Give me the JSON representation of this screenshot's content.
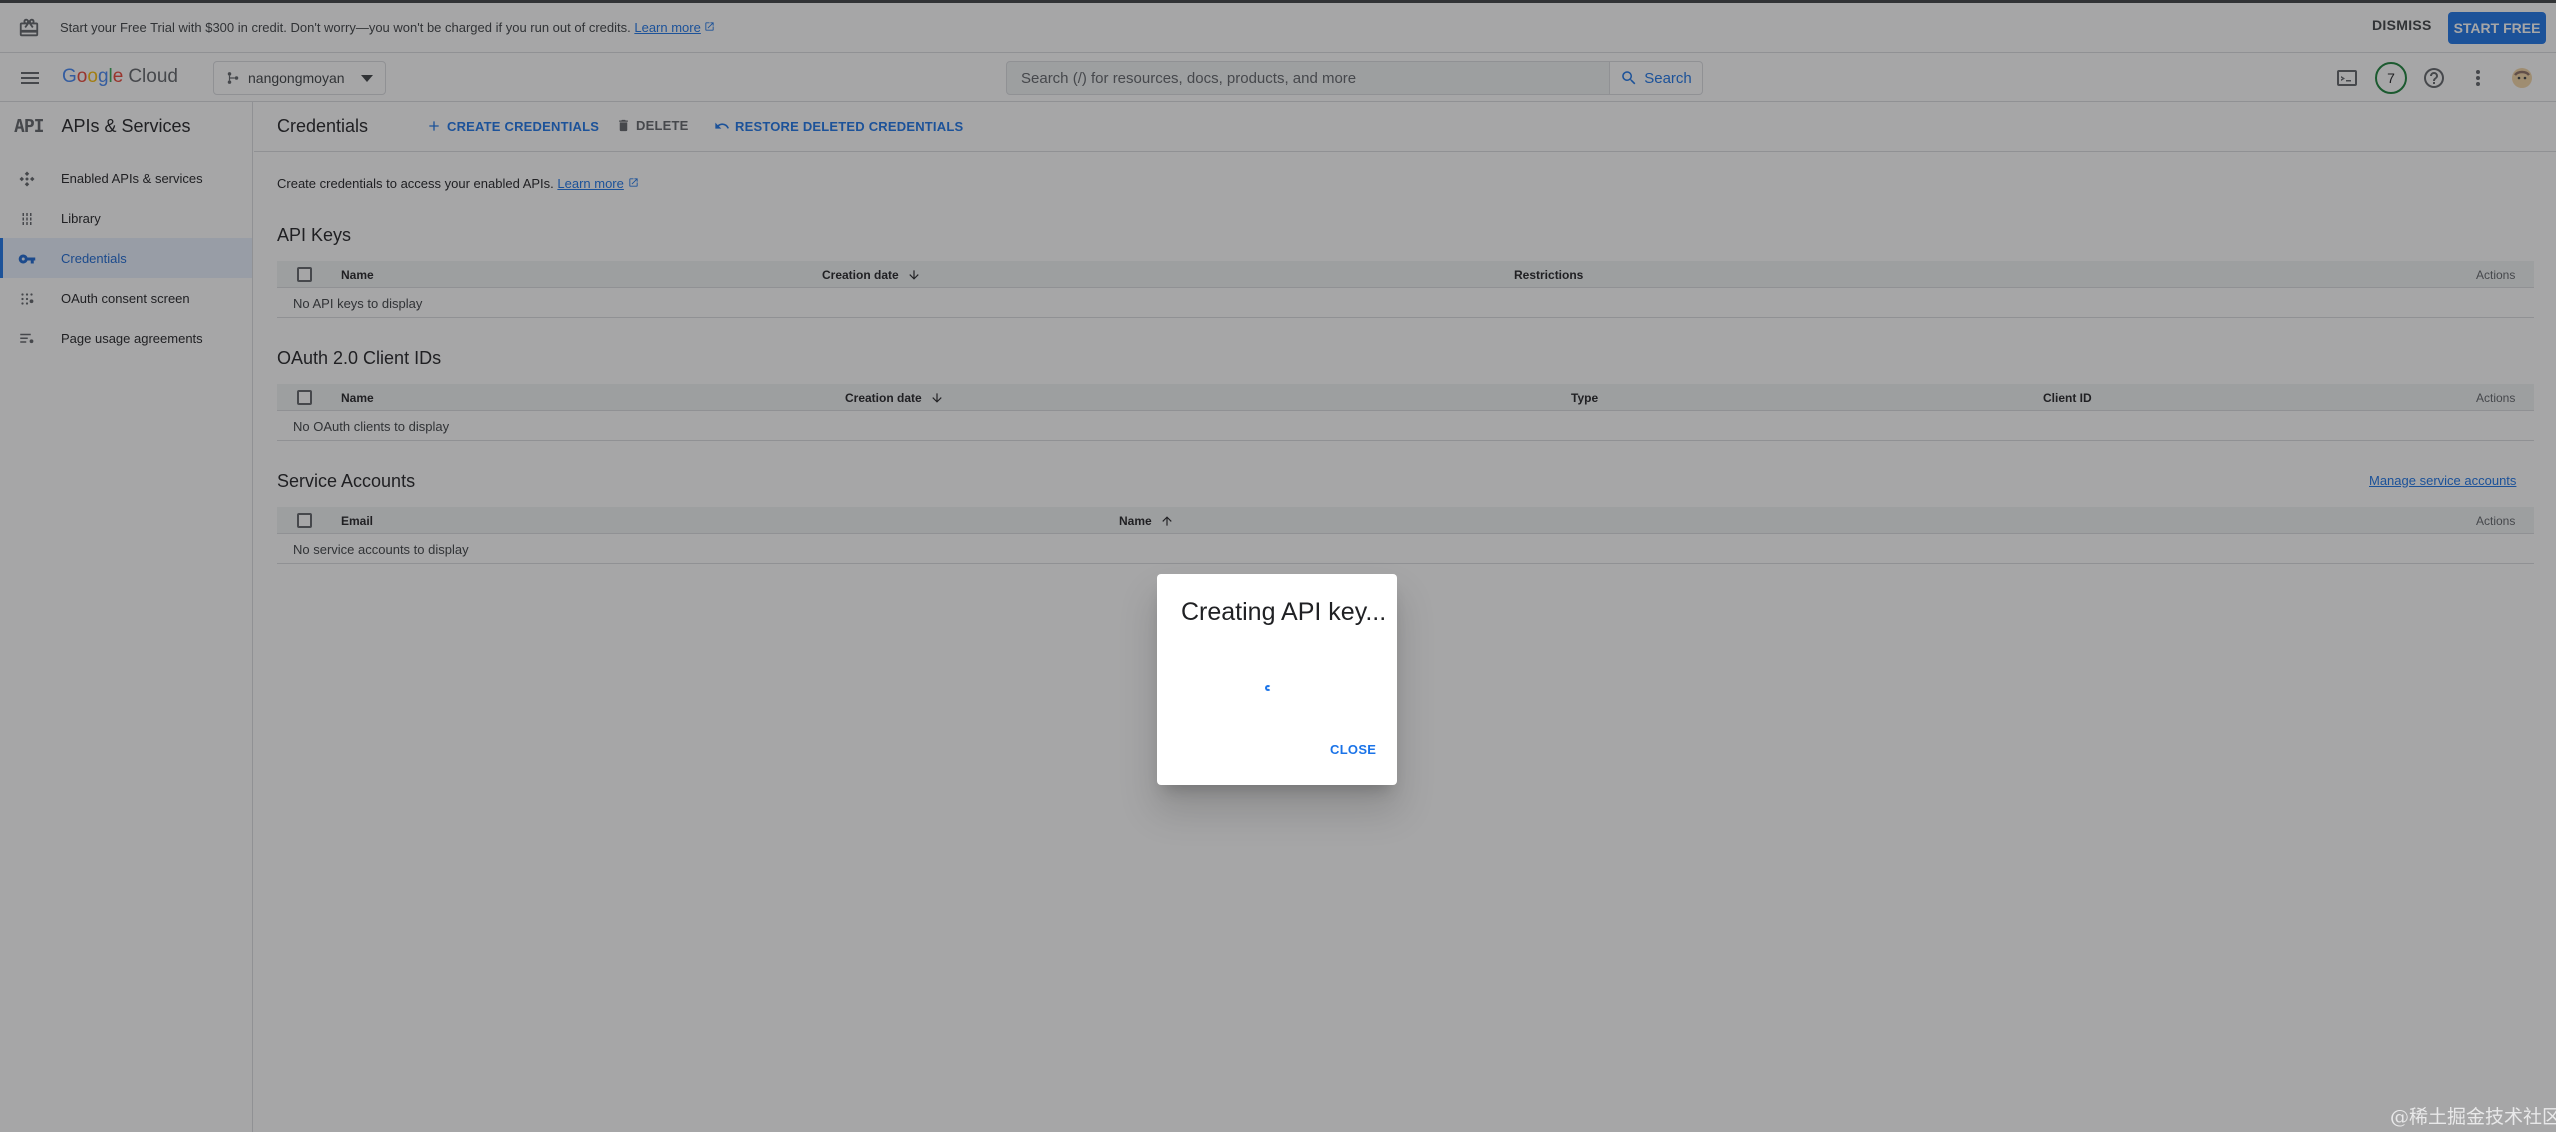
{
  "trial_banner": {
    "message": "Start your Free Trial with $300 in credit. Don't worry—you won't be charged if you run out of credits.",
    "learn_more": "Learn more",
    "dismiss": "DISMISS",
    "start_free": "START FREE"
  },
  "header": {
    "logo_google": "Google",
    "logo_cloud": "Cloud",
    "project": "nangongmoyan",
    "search_placeholder": "Search (/) for resources, docs, products, and more",
    "search_button": "Search",
    "notification_count": "7"
  },
  "sidebar": {
    "logo": "API",
    "title": "APIs & Services",
    "items": [
      {
        "label": "Enabled APIs & services",
        "icon": "hub-icon"
      },
      {
        "label": "Library",
        "icon": "library-grid-icon"
      },
      {
        "label": "Credentials",
        "icon": "key-icon",
        "active": true
      },
      {
        "label": "OAuth consent screen",
        "icon": "consent-dots-icon"
      },
      {
        "label": "Page usage agreements",
        "icon": "settings-list-icon"
      }
    ]
  },
  "toolbar": {
    "title": "Credentials",
    "create": "CREATE CREDENTIALS",
    "delete": "DELETE",
    "restore": "RESTORE DELETED CREDENTIALS"
  },
  "main": {
    "intro": "Create credentials to access your enabled APIs.",
    "learn_more": "Learn more",
    "api_keys": {
      "title": "API Keys",
      "columns": [
        "Name",
        "Creation date",
        "Restrictions",
        "Actions"
      ],
      "empty": "No API keys to display"
    },
    "oauth": {
      "title": "OAuth 2.0 Client IDs",
      "columns": [
        "Name",
        "Creation date",
        "Type",
        "Client ID",
        "Actions"
      ],
      "empty": "No OAuth clients to display"
    },
    "service_accounts": {
      "title": "Service Accounts",
      "manage_link": "Manage service accounts",
      "columns": [
        "Email",
        "Name",
        "Actions"
      ],
      "empty": "No service accounts to display"
    }
  },
  "dialog": {
    "title": "Creating API key...",
    "close": "CLOSE"
  },
  "watermark": "@稀土掘金技术社区",
  "colors": {
    "accent": "#1a73e8",
    "active_bg": "#e8f0fe",
    "header_bg": "#f1f3f4"
  }
}
